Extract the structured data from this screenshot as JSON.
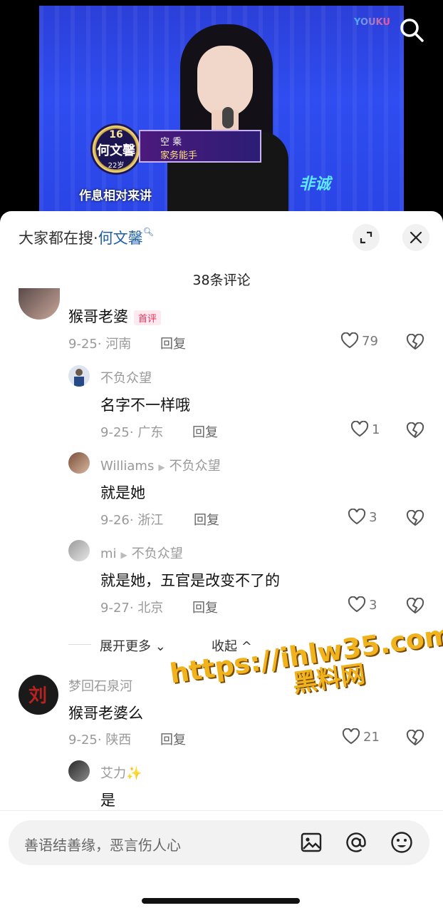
{
  "video": {
    "badge_number": "16",
    "badge_name": "何文馨",
    "badge_age": "22岁",
    "job_line1": "空  乘",
    "job_line2": "家务能手",
    "subtitle": "作息相对来讲",
    "logo": "YOUKU",
    "stage_logo": "非诚"
  },
  "header": {
    "search_prefix": "大家都在搜·",
    "search_term": "何文馨",
    "comment_count": "38条评论"
  },
  "comments": [
    {
      "user": "",
      "text": "猴哥老婆",
      "tag": "首评",
      "date": "9-25",
      "region": "河南",
      "reply": "回复",
      "likes": "79"
    },
    {
      "user": "不负众望",
      "text": "名字不一样哦",
      "date": "9-25",
      "region": "广东",
      "reply": "回复",
      "likes": "1"
    },
    {
      "user": "Williams",
      "reply_to": "不负众望",
      "text": "就是她",
      "date": "9-26",
      "region": "浙江",
      "reply": "回复",
      "likes": "3"
    },
    {
      "user": "mi",
      "reply_to": "不负众望",
      "text": "就是她，五官是改变不了的",
      "date": "9-27",
      "region": "北京",
      "reply": "回复",
      "likes": "3"
    },
    {
      "user": "梦回石泉河",
      "text": "猴哥老婆么",
      "date": "9-25",
      "region": "陕西",
      "reply": "回复",
      "likes": "21"
    },
    {
      "user": "艾力✨",
      "text": "是"
    }
  ],
  "thread": {
    "expand_more": "展开更多",
    "collapse": "收起"
  },
  "watermark": {
    "line1": "https://ihlw35.com",
    "line2": "黑料网"
  },
  "input": {
    "placeholder": "善语结善缘，恶言伤人心"
  },
  "icons": [
    "search-icon",
    "expand-icon",
    "close-icon",
    "heart-icon",
    "broken-heart-icon",
    "image-icon",
    "at-icon",
    "emoji-icon"
  ]
}
